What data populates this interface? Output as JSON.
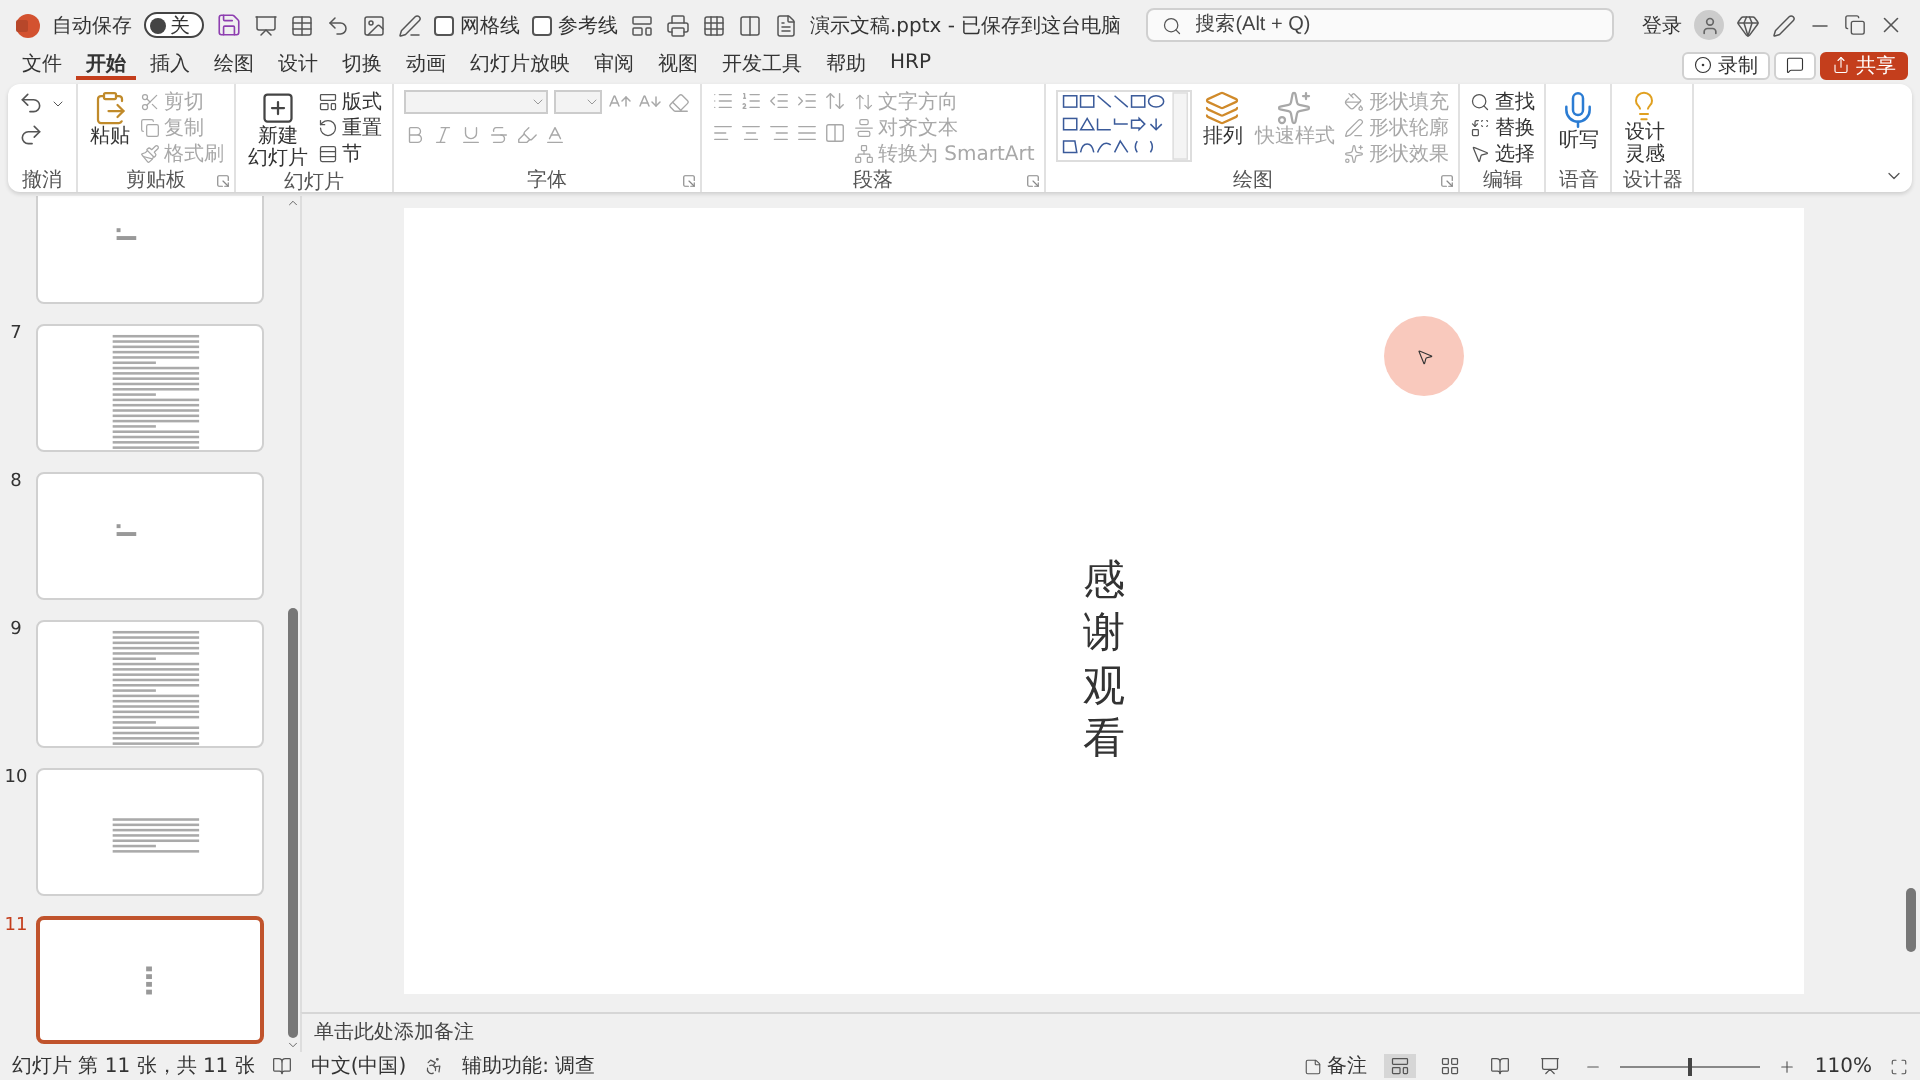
{
  "title_bar": {
    "autosave_label": "自动保存",
    "autosave_on": false,
    "autosave_state": "关",
    "checkboxes": [
      {
        "label": "网格线",
        "checked": false
      },
      {
        "label": "参考线",
        "checked": false
      }
    ],
    "filename": "演示文稿.pptx - 已保存到这台电脑",
    "search_placeholder": "搜索(Alt + Q)",
    "user": "登录"
  },
  "tabs": [
    {
      "label": "文件",
      "selected": false
    },
    {
      "label": "开始",
      "selected": true
    },
    {
      "label": "插入",
      "selected": false
    },
    {
      "label": "绘图",
      "selected": false
    },
    {
      "label": "设计",
      "selected": false
    },
    {
      "label": "切换",
      "selected": false
    },
    {
      "label": "动画",
      "selected": false
    },
    {
      "label": "幻灯片放映",
      "selected": false
    },
    {
      "label": "审阅",
      "selected": false
    },
    {
      "label": "视图",
      "selected": false
    },
    {
      "label": "开发工具",
      "selected": false
    },
    {
      "label": "帮助",
      "selected": false
    },
    {
      "label": "HRP",
      "selected": false
    }
  ],
  "actions": {
    "record": "录制",
    "share": "共享"
  },
  "ribbon": {
    "undo": {
      "name": "撤消"
    },
    "clipboard": {
      "name": "剪贴板",
      "launcher": true,
      "paste": "粘贴",
      "cut": {
        "label": "剪切",
        "disabled": true
      },
      "copy": {
        "label": "复制",
        "disabled": true
      },
      "format_painter": {
        "label": "格式刷",
        "disabled": true
      }
    },
    "slides": {
      "name": "幻灯片",
      "new_slide": [
        "新建",
        "幻灯片"
      ],
      "layout": "版式",
      "reset": "重置",
      "section": "节"
    },
    "font": {
      "name": "字体",
      "launcher": true,
      "disabled": true
    },
    "paragraph": {
      "name": "段落",
      "launcher": true,
      "text_direction": {
        "label": "文字方向",
        "disabled": true
      },
      "align_text": {
        "label": "对齐文本",
        "disabled": true
      },
      "smartart": {
        "label": "转换为 SmartArt",
        "disabled": true
      }
    },
    "drawing": {
      "name": "绘图",
      "launcher": true,
      "arrange": "排列",
      "quick_styles": {
        "label": "快速样式",
        "disabled": true
      },
      "fill": {
        "label": "形状填充",
        "disabled": true
      },
      "outline": {
        "label": "形状轮廓",
        "disabled": true
      },
      "effects": {
        "label": "形状效果",
        "disabled": true
      }
    },
    "editing": {
      "name": "编辑",
      "find": "查找",
      "replace": "替换",
      "select": "选择"
    },
    "voice": {
      "name": "语音",
      "dictate": "听写"
    },
    "designer": {
      "name": "设计器",
      "ideas": [
        "设计",
        "灵感"
      ]
    }
  },
  "slides_panel": [
    {
      "kind": "title",
      "selected": false
    },
    {
      "number": "7",
      "kind": "text",
      "selected": false
    },
    {
      "number": "8",
      "kind": "title",
      "selected": false
    },
    {
      "number": "9",
      "kind": "text",
      "selected": false
    },
    {
      "number": "10",
      "kind": "paragraph",
      "selected": false
    },
    {
      "number": "11",
      "kind": "vertical",
      "selected": true
    }
  ],
  "slide": {
    "text": "感谢观看"
  },
  "notes": {
    "placeholder": "单击此处添加备注"
  },
  "status_bar": {
    "slide_info": "幻灯片 第 11 张，共 11 张",
    "language": "中文(中国)",
    "accessibility": "辅助功能: 调查",
    "notes": "备注",
    "zoom": "110%",
    "zoom_level": {
      "level": 0.5
    }
  }
}
